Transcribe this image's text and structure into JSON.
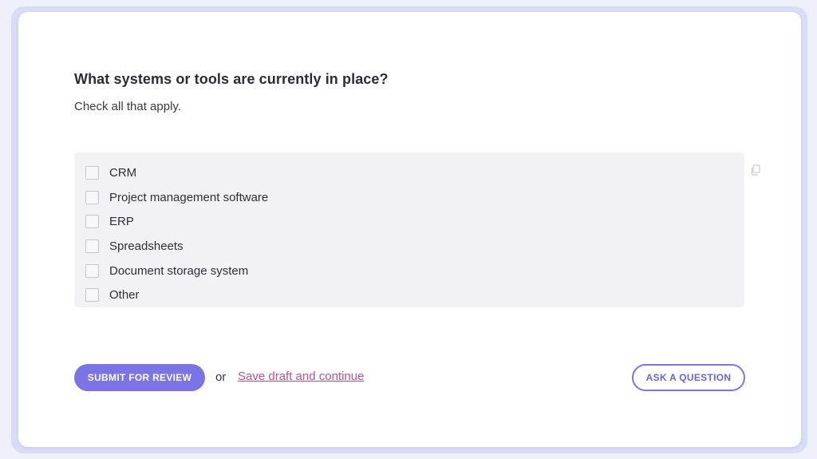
{
  "question": {
    "title": "What systems or tools are currently in place?",
    "hint": "Check all that apply."
  },
  "options": [
    {
      "label": "CRM",
      "checked": false
    },
    {
      "label": "Project management software",
      "checked": false
    },
    {
      "label": "ERP",
      "checked": false
    },
    {
      "label": "Spreadsheets",
      "checked": false
    },
    {
      "label": "Document storage system",
      "checked": false
    },
    {
      "label": "Other",
      "checked": false
    }
  ],
  "actions": {
    "submit_label": "SUBMIT FOR REVIEW",
    "or_text": "or",
    "save_draft_label": "Save draft and continue",
    "ask_label": "ASK A QUESTION"
  },
  "icons": {
    "copy": "copy-icon"
  },
  "colors": {
    "accent": "#7b74e6",
    "link": "#c0508f",
    "panel_bg": "#f2f2f6"
  }
}
